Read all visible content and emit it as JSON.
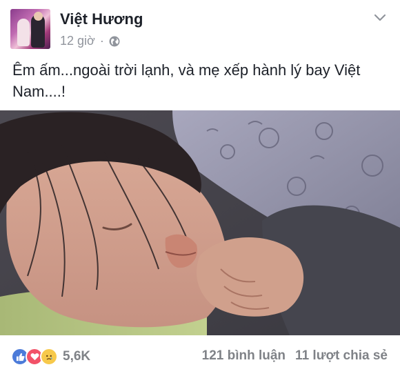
{
  "post": {
    "author": "Việt Hương",
    "time": "12 giờ",
    "separator": "·",
    "privacy_icon": "globe-icon",
    "menu_icon": "chevron-down-icon",
    "text": "Êm ấm...ngoài trời lạnh, và mẹ xếp hành lý bay Việt Nam....!"
  },
  "reactions": {
    "icons": [
      "like-icon",
      "love-icon",
      "sad-icon"
    ],
    "count": "5,6K"
  },
  "stats": {
    "comments": "121 bình luận",
    "shares": "11 lượt chia sẻ"
  },
  "colors": {
    "text": "#1d2129",
    "meta": "#90949c",
    "like": "#4c7bd9",
    "love": "#f25268",
    "sad": "#f7c94b"
  }
}
